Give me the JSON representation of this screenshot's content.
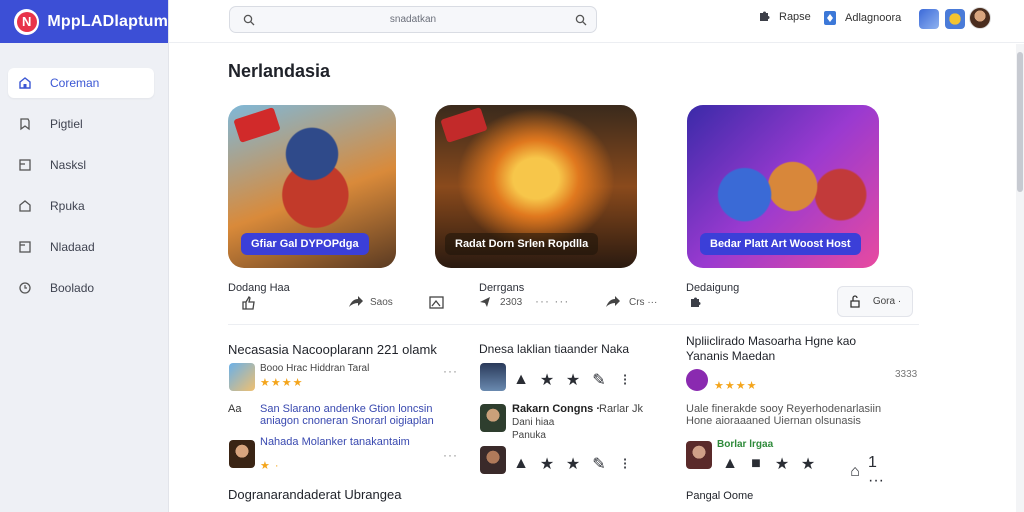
{
  "app": {
    "name": "MppLADlaptum",
    "logo_letter": "N"
  },
  "search": {
    "placeholder": "snadatkan"
  },
  "topbar": {
    "action1": "Rapse",
    "action2": "Adlagnoora"
  },
  "sidebar": {
    "items": [
      {
        "label": "Coreman",
        "icon": "home-icon"
      },
      {
        "label": "Pigtiel",
        "icon": "bookmark-icon"
      },
      {
        "label": "Nasksl",
        "icon": "panel-icon"
      },
      {
        "label": "Rpuka",
        "icon": "bag-icon"
      },
      {
        "label": "Nladaad",
        "icon": "file-icon"
      },
      {
        "label": "Boolado",
        "icon": "clock-icon"
      }
    ]
  },
  "main": {
    "title": "Nerlandasia",
    "cards": [
      {
        "caption": "Gfiar Gal DYPOPdga",
        "label": "Dodang Haa",
        "art_colors": [
          "#c23a2a",
          "#f0a640",
          "#3a6ad6"
        ],
        "caption_bg": "#3b3fd8"
      },
      {
        "caption": "Radat Dorn Srlen Ropdlla",
        "label": "Derrgans",
        "art_colors": [
          "#3a1c10",
          "#f0a030",
          "#c45a1a"
        ],
        "caption_bg": "rgba(30,20,10,0.55)"
      },
      {
        "caption": "Bedar Platt Art Woost Host",
        "label": "Dedaigung",
        "art_colors": [
          "#4a2aa8",
          "#e84aa0",
          "#f3c431"
        ],
        "caption_bg": "#3b3fd8"
      }
    ],
    "card_actions": {
      "c1_icon": "like-icon",
      "c1_share": "Saos",
      "c2_count": "2303",
      "c2_more": "Crs ···",
      "c3_btn": "Gora ·"
    },
    "feed": {
      "col1": {
        "title": "Necasasia Nacooplarann 221 olamk",
        "author": "Booo Hrac Hiddran Taral",
        "author_highlight": "Hrac",
        "stars": "★★★★",
        "text_prefix": "Aa",
        "text": "San Slarano andenke Gtion loncsin aniagon cnoneran Snorarl oigiaplan",
        "author2": "Nahada Molanker tanakantaim",
        "footer": "Dogranarandaderat Ubrangea"
      },
      "col2": {
        "title": "Dnesa laklian tiaander Naka",
        "row2_title": "Rakarn Congns ·",
        "row2_sub": "Rarlar Jk",
        "row2_meta1": "Dani hiaa",
        "row2_meta2": "Panuka"
      },
      "col3": {
        "title": "Npliiclirado Masoarha Hgne kao Yananis Maedan",
        "stars": "★★★★",
        "time": "3333",
        "text": "Uale finerakde sooy Reyerhodenarlasiin Hone aioraaaned Uiernan olsunasis",
        "badge": "Borlar lrgaa",
        "footer": "Pangal Oome"
      }
    }
  },
  "colors": {
    "brand": "#3c4fd6",
    "accent": "#3b57d4",
    "star": "#f4a51c"
  }
}
